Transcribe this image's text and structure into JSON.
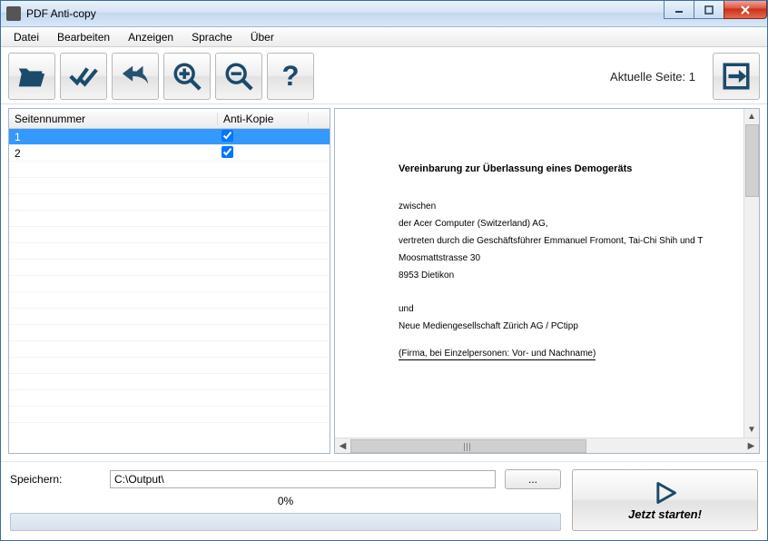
{
  "window": {
    "title": "PDF Anti-copy"
  },
  "menu": {
    "items": [
      "Datei",
      "Bearbeiten",
      "Anzeigen",
      "Sprache",
      "Über"
    ]
  },
  "toolbar": {
    "current_page_label": "Aktuelle Seite: 1"
  },
  "table": {
    "col_page": "Seitennummer",
    "col_anti": "Anti-Kopie",
    "rows": [
      {
        "page": "1",
        "checked": true,
        "selected": true
      },
      {
        "page": "2",
        "checked": true,
        "selected": false
      }
    ]
  },
  "preview": {
    "title": "Vereinbarung zur Überlassung eines Demogeräts",
    "l1": "zwischen",
    "l2": "der Acer Computer (Switzerland) AG,",
    "l3": "vertreten durch die Geschäftsführer Emmanuel Fromont, Tai-Chi Shih und T",
    "l4": "Moosmattstrasse 30",
    "l5": "8953 Dietikon",
    "l6": "und",
    "l7": "Neue Mediengesellschaft Zürich AG / PCtipp",
    "l8": "(Firma, bei Einzelpersonen: Vor- und Nachname)"
  },
  "bottom": {
    "save_label": "Speichern:",
    "output_path": "C:\\Output\\",
    "browse_label": "...",
    "progress_text": "0%",
    "start_label": "Jetzt starten!"
  }
}
